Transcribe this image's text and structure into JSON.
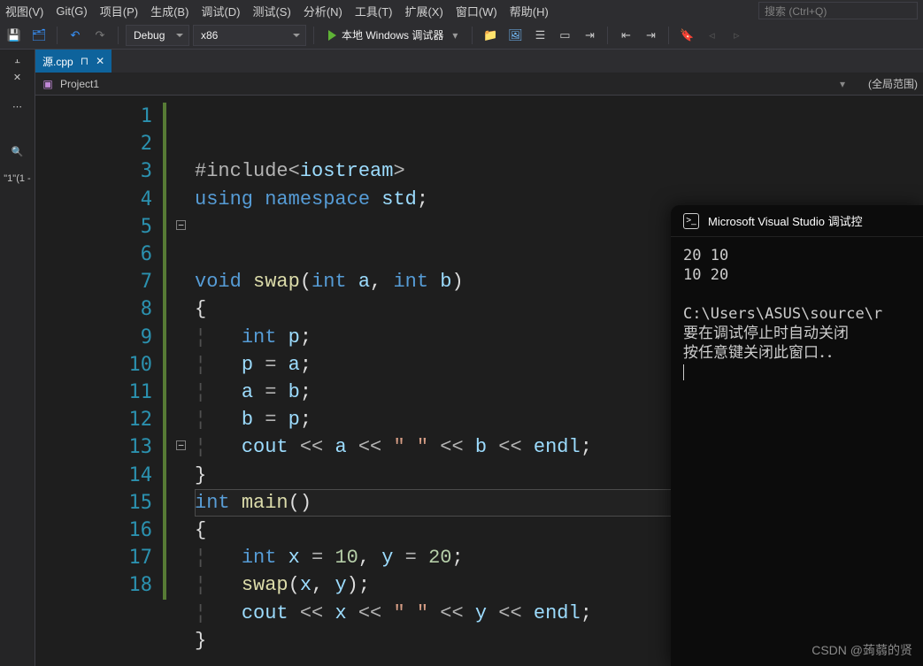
{
  "menu": {
    "view": "视图(V)",
    "git": "Git(G)",
    "project": "项目(P)",
    "build": "生成(B)",
    "debug": "调试(D)",
    "test": "测试(S)",
    "analyze": "分析(N)",
    "tools": "工具(T)",
    "extensions": "扩展(X)",
    "window": "窗口(W)",
    "help": "帮助(H)"
  },
  "search": {
    "placeholder": "搜索 (Ctrl+Q)"
  },
  "toolbar": {
    "config": "Debug",
    "platform": "x86",
    "run": "本地 Windows 调试器"
  },
  "left": {
    "label": "\"1\"(1 -"
  },
  "tab": {
    "name": "源.cpp"
  },
  "nav": {
    "project": "Project1",
    "scope": "(全局范围)"
  },
  "code": {
    "lines": [
      1,
      2,
      3,
      4,
      5,
      6,
      7,
      8,
      9,
      10,
      11,
      12,
      13,
      14,
      15,
      16,
      17,
      18
    ],
    "current_line": 15,
    "fold": {
      "5": "minus",
      "13": "minus"
    },
    "src": {
      "l1": {
        "include": "#include",
        "lt": "<",
        "hdr": "iostream",
        "gt": ">"
      },
      "l2": {
        "using": "using",
        "namespace": "namespace",
        "std": "std",
        "semi": ";"
      },
      "l5": {
        "void": "void",
        "swap": "swap",
        "lp": "(",
        "int1": "int",
        "a": "a",
        "comma": ",",
        "int2": "int",
        "b": "b",
        "rp": ")"
      },
      "l6": {
        "brace": "{"
      },
      "l7": {
        "int": "int",
        "p": "p",
        "semi": ";"
      },
      "l8": {
        "p": "p",
        "eq": "=",
        "a": "a",
        "semi": ";"
      },
      "l9": {
        "a": "a",
        "eq": "=",
        "b": "b",
        "semi": ";"
      },
      "l10": {
        "b": "b",
        "eq": "=",
        "p": "p",
        "semi": ";"
      },
      "l11": {
        "cout": "cout",
        "a": "a",
        "sp": "\" \"",
        "b": "b",
        "endl": "endl",
        "semi": ";"
      },
      "l12": {
        "brace": "}"
      },
      "l13": {
        "int": "int",
        "main": "main",
        "lp": "(",
        "rp": ")"
      },
      "l14": {
        "brace": "{"
      },
      "l15": {
        "int": "int",
        "x": "x",
        "eq1": "=",
        "v10": "10",
        "comma": ",",
        "y": "y",
        "eq2": "=",
        "v20": "20",
        "semi": ";"
      },
      "l16": {
        "swap": "swap",
        "lp": "(",
        "x": "x",
        "comma": ",",
        "y": "y",
        "rp": ")",
        "semi": ";"
      },
      "l17": {
        "cout": "cout",
        "x": "x",
        "sp": "\" \"",
        "y": "y",
        "endl": "endl",
        "semi": ";"
      },
      "l18": {
        "brace": "}"
      }
    }
  },
  "console": {
    "title": "Microsoft Visual Studio 调试控",
    "out1": "20 10",
    "out2": "10 20",
    "path": "C:\\Users\\ASUS\\source\\r",
    "msg1": "要在调试停止时自动关闭",
    "msg2": "按任意键关闭此窗口．．"
  },
  "watermark": "CSDN @蒟蒻的贤"
}
